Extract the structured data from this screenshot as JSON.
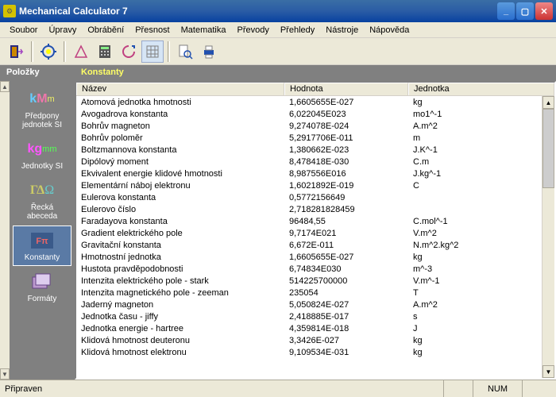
{
  "window": {
    "title": "Mechanical Calculator 7"
  },
  "menu": [
    "Soubor",
    "Úpravy",
    "Obrábění",
    "Přesnost",
    "Matematika",
    "Převody",
    "Přehledy",
    "Nástroje",
    "Nápověda"
  ],
  "sidebar_title": "Položky",
  "main_title": "Konstanty",
  "sidebar": [
    {
      "label": "Předpony jednotek SI"
    },
    {
      "label": "Jednotky SI"
    },
    {
      "label": "Řecká abeceda"
    },
    {
      "label": "Konstanty"
    },
    {
      "label": "Formáty"
    }
  ],
  "columns": {
    "name": "Název",
    "value": "Hodnota",
    "unit": "Jednotka"
  },
  "rows": [
    {
      "n": "Atomová jednotka hmotnosti",
      "v": "1,6605655E-027",
      "u": "kg"
    },
    {
      "n": "Avogadrova konstanta",
      "v": "6,022045E023",
      "u": "mo1^-1"
    },
    {
      "n": "Bohrův magneton",
      "v": "9,274078E-024",
      "u": "A.m^2"
    },
    {
      "n": "Bohrův poloměr",
      "v": "5,2917706E-011",
      "u": "m"
    },
    {
      "n": "Boltzmannova konstanta",
      "v": "1,380662E-023",
      "u": "J.K^-1"
    },
    {
      "n": "Dipólový moment",
      "v": "8,478418E-030",
      "u": "C.m"
    },
    {
      "n": "Ekvivalent energie klidové hmotnosti",
      "v": "8,987556E016",
      "u": "J.kg^-1"
    },
    {
      "n": "Elementární náboj elektronu",
      "v": "1,6021892E-019",
      "u": "C"
    },
    {
      "n": "Eulerova konstanta",
      "v": "0,5772156649",
      "u": ""
    },
    {
      "n": "Eulerovo číslo",
      "v": "2,718281828459",
      "u": ""
    },
    {
      "n": "Faradayova konstanta",
      "v": "96484,55",
      "u": "C.mol^-1"
    },
    {
      "n": "Gradient elektrického pole",
      "v": "9,7174E021",
      "u": "V.m^2"
    },
    {
      "n": "Gravitační konstanta",
      "v": "6,672E-011",
      "u": "N.m^2.kg^2"
    },
    {
      "n": "Hmotnostní jednotka",
      "v": "1,6605655E-027",
      "u": "kg"
    },
    {
      "n": "Hustota pravděpodobnosti",
      "v": "6,74834E030",
      "u": "m^-3"
    },
    {
      "n": "Intenzita elektrického pole - stark",
      "v": "514225700000",
      "u": "V.m^-1"
    },
    {
      "n": "Intenzita magnetického pole - zeeman",
      "v": "235054",
      "u": "T"
    },
    {
      "n": "Jaderný magneton",
      "v": "5,050824E-027",
      "u": "A.m^2"
    },
    {
      "n": "Jednotka času - jiffy",
      "v": "2,418885E-017",
      "u": "s"
    },
    {
      "n": "Jednotka energie - hartree",
      "v": "4,359814E-018",
      "u": "J"
    },
    {
      "n": "Klidová hmotnost deuteronu",
      "v": "3,3426E-027",
      "u": "kg"
    },
    {
      "n": "Klidová hmotnost elektronu",
      "v": "9,109534E-031",
      "u": "kg"
    }
  ],
  "status": {
    "ready": "Připraven",
    "num": "NUM"
  }
}
